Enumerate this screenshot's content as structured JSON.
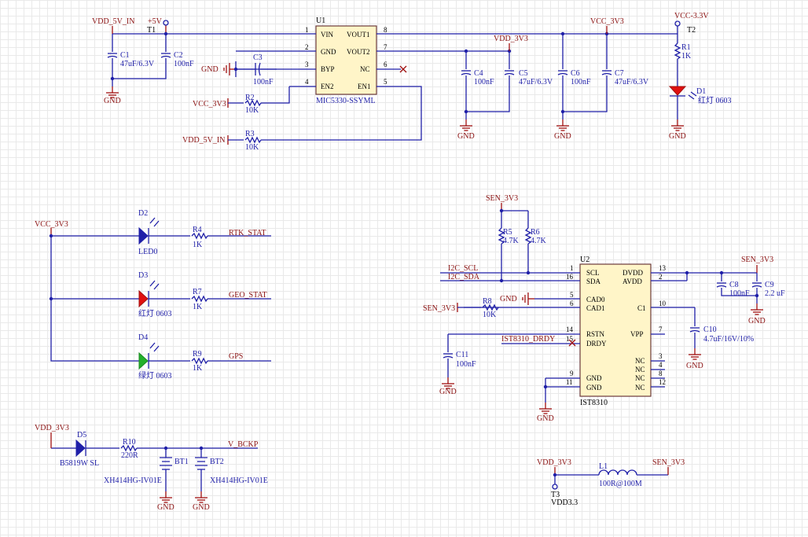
{
  "u1": {
    "designator": "U1",
    "part": "MIC5330-SSYML",
    "pins_left": [
      {
        "num": "1",
        "name": "VIN"
      },
      {
        "num": "2",
        "name": "GND"
      },
      {
        "num": "3",
        "name": "BYP"
      },
      {
        "num": "4",
        "name": "EN2"
      }
    ],
    "pins_right": [
      {
        "num": "8",
        "name": "VOUT1"
      },
      {
        "num": "7",
        "name": "VOUT2"
      },
      {
        "num": "6",
        "name": "NC"
      },
      {
        "num": "5",
        "name": "EN1"
      }
    ]
  },
  "u2": {
    "designator": "U2",
    "part": "IST8310",
    "pins_left": [
      {
        "num": "1",
        "name": "SCL"
      },
      {
        "num": "16",
        "name": "SDA"
      },
      {
        "num": "5",
        "name": "CAD0"
      },
      {
        "num": "6",
        "name": "CAD1"
      },
      {
        "num": "14",
        "name": "RSTN"
      },
      {
        "num": "15",
        "name": "DRDY"
      },
      {
        "num": "9",
        "name": "GND"
      },
      {
        "num": "11",
        "name": "GND"
      }
    ],
    "pins_right": [
      {
        "num": "13",
        "name": "DVDD"
      },
      {
        "num": "2",
        "name": "AVDD"
      },
      {
        "num": "10",
        "name": "C1"
      },
      {
        "num": "7",
        "name": "VPP"
      },
      {
        "num": "3",
        "name": "NC"
      },
      {
        "num": "4",
        "name": "NC"
      },
      {
        "num": "8",
        "name": "NC"
      },
      {
        "num": "12",
        "name": "NC"
      }
    ]
  },
  "nets": {
    "vdd_5v_in": "VDD_5V_IN",
    "plus5v": "+5V",
    "vcc_3v3": "VCC_3V3",
    "vdd_3v3": "VDD_3V3",
    "vcc_m33": "VCC-3.3V",
    "sen_3v3": "SEN_3V3",
    "gnd": "GND",
    "rtk": "RTK_STAT",
    "geo": "GEO_STAT",
    "gps": "GPS",
    "vbckp": "V_BCKP",
    "i2c_scl": "I2C_SCL",
    "i2c_sda": "I2C_SDA",
    "drdy": "IST8310_DRDY",
    "vdd33": "VDD3.3"
  },
  "testpoints": {
    "t1": "T1",
    "t2": "T2",
    "t3": "T3"
  },
  "caps": [
    {
      "ref": "C1",
      "value": "47uF/6.3V"
    },
    {
      "ref": "C2",
      "value": "100nF"
    },
    {
      "ref": "C3",
      "value": "100nF"
    },
    {
      "ref": "C4",
      "value": "100nF"
    },
    {
      "ref": "C5",
      "value": "47uF/6.3V"
    },
    {
      "ref": "C6",
      "value": "100nF"
    },
    {
      "ref": "C7",
      "value": "47uF/6.3V"
    },
    {
      "ref": "C8",
      "value": "100nF"
    },
    {
      "ref": "C9",
      "value": "2.2 uF"
    },
    {
      "ref": "C10",
      "value": "4.7uF/16V/10%"
    },
    {
      "ref": "C11",
      "value": "100nF"
    }
  ],
  "resistors": [
    {
      "ref": "R1",
      "value": "1K"
    },
    {
      "ref": "R2",
      "value": "10K"
    },
    {
      "ref": "R3",
      "value": "10K"
    },
    {
      "ref": "R4",
      "value": "1K"
    },
    {
      "ref": "R5",
      "value": "4.7K"
    },
    {
      "ref": "R6",
      "value": "4.7K"
    },
    {
      "ref": "R7",
      "value": "1K"
    },
    {
      "ref": "R8",
      "value": "10K"
    },
    {
      "ref": "R9",
      "value": "1K"
    },
    {
      "ref": "R10",
      "value": "220R"
    }
  ],
  "leds": [
    {
      "ref": "D1",
      "value": "红灯 0603",
      "color": "#e01010"
    },
    {
      "ref": "D2",
      "value": "LED0",
      "color": "#1f1fa8"
    },
    {
      "ref": "D3",
      "value": "红灯 0603",
      "color": "#e01010"
    },
    {
      "ref": "D4",
      "value": "绿灯 0603",
      "color": "#22b02a"
    }
  ],
  "diode": {
    "ref": "D5",
    "value": "B5819W SL"
  },
  "batteries": [
    {
      "ref": "BT1",
      "value": "XH414HG-IV01E"
    },
    {
      "ref": "BT2",
      "value": "XH414HG-IV01E"
    }
  ],
  "inductor": {
    "ref": "L1",
    "value": "100R@100M"
  }
}
